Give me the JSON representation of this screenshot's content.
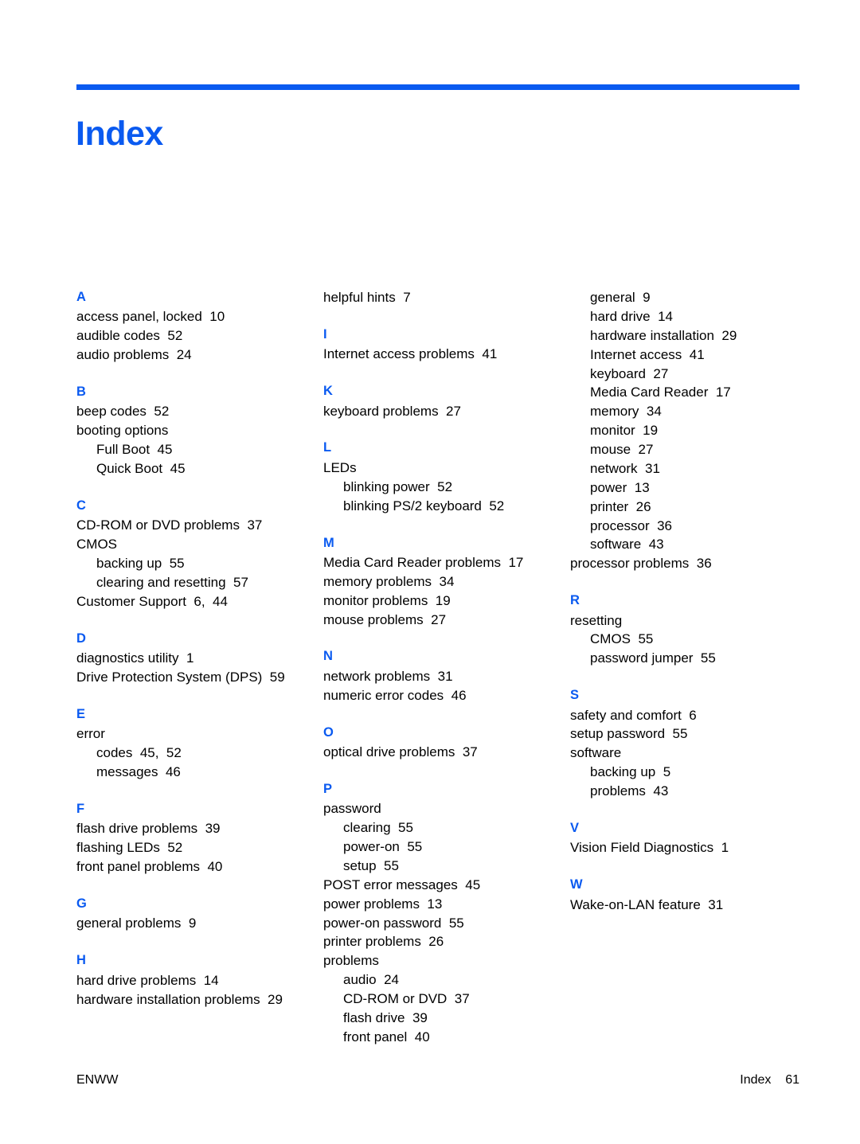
{
  "document": {
    "title": "Index",
    "accent_color": "#0A5AF0",
    "text_color": "#000000"
  },
  "footer": {
    "left": "ENWW",
    "right": "Index    61"
  },
  "columns": [
    {
      "id": "column-1",
      "groups": [
        {
          "letter": "A",
          "entries": [
            {
              "text": "access panel, locked",
              "locator": "10",
              "level": 0
            },
            {
              "text": "audible codes",
              "locator": "52",
              "level": 0
            },
            {
              "text": "audio problems",
              "locator": "24",
              "level": 0
            }
          ]
        },
        {
          "letter": "B",
          "entries": [
            {
              "text": "beep codes",
              "locator": "52",
              "level": 0
            },
            {
              "text": "booting options",
              "locator": "",
              "level": 0
            },
            {
              "text": "Full Boot",
              "locator": "45",
              "level": 1
            },
            {
              "text": "Quick Boot",
              "locator": "45",
              "level": 1
            }
          ]
        },
        {
          "letter": "C",
          "entries": [
            {
              "text": "CD-ROM or DVD problems",
              "locator": "37",
              "level": 0
            },
            {
              "text": "CMOS",
              "locator": "",
              "level": 0
            },
            {
              "text": "backing up",
              "locator": "55",
              "level": 1
            },
            {
              "text": "clearing and resetting",
              "locator": "57",
              "level": 1
            },
            {
              "text": "Customer Support",
              "locator": "6,  44",
              "level": 0
            }
          ]
        },
        {
          "letter": "D",
          "entries": [
            {
              "text": "diagnostics utility",
              "locator": "1",
              "level": 0
            },
            {
              "text": "Drive Protection System (DPS)",
              "locator": "59",
              "level": 0
            }
          ]
        },
        {
          "letter": "E",
          "entries": [
            {
              "text": "error",
              "locator": "",
              "level": 0
            },
            {
              "text": "codes",
              "locator": "45,  52",
              "level": 1
            },
            {
              "text": "messages",
              "locator": "46",
              "level": 1
            }
          ]
        },
        {
          "letter": "F",
          "entries": [
            {
              "text": "flash drive problems",
              "locator": "39",
              "level": 0
            },
            {
              "text": "flashing LEDs",
              "locator": "52",
              "level": 0
            },
            {
              "text": "front panel problems",
              "locator": "40",
              "level": 0
            }
          ]
        },
        {
          "letter": "G",
          "entries": [
            {
              "text": "general problems",
              "locator": "9",
              "level": 0
            }
          ]
        },
        {
          "letter": "H",
          "entries": [
            {
              "text": "hard drive problems",
              "locator": "14",
              "level": 0
            },
            {
              "text": "hardware installation problems",
              "locator": "29",
              "level": 0
            }
          ]
        }
      ]
    },
    {
      "id": "column-2",
      "continued": [
        {
          "text": "helpful hints",
          "locator": "7",
          "level": 0
        }
      ],
      "groups": [
        {
          "letter": "I",
          "entries": [
            {
              "text": "Internet access problems",
              "locator": "41",
              "level": 0
            }
          ]
        },
        {
          "letter": "K",
          "entries": [
            {
              "text": "keyboard problems",
              "locator": "27",
              "level": 0
            }
          ]
        },
        {
          "letter": "L",
          "entries": [
            {
              "text": "LEDs",
              "locator": "",
              "level": 0
            },
            {
              "text": "blinking power",
              "locator": "52",
              "level": 1
            },
            {
              "text": "blinking PS/2 keyboard",
              "locator": "52",
              "level": 1
            }
          ]
        },
        {
          "letter": "M",
          "entries": [
            {
              "text": "Media Card Reader problems",
              "locator": "17",
              "level": 0
            },
            {
              "text": "memory problems",
              "locator": "34",
              "level": 0
            },
            {
              "text": "monitor problems",
              "locator": "19",
              "level": 0
            },
            {
              "text": "mouse problems",
              "locator": "27",
              "level": 0
            }
          ]
        },
        {
          "letter": "N",
          "entries": [
            {
              "text": "network problems",
              "locator": "31",
              "level": 0
            },
            {
              "text": "numeric error codes",
              "locator": "46",
              "level": 0
            }
          ]
        },
        {
          "letter": "O",
          "entries": [
            {
              "text": "optical drive problems",
              "locator": "37",
              "level": 0
            }
          ]
        },
        {
          "letter": "P",
          "entries": [
            {
              "text": "password",
              "locator": "",
              "level": 0
            },
            {
              "text": "clearing",
              "locator": "55",
              "level": 1
            },
            {
              "text": "power-on",
              "locator": "55",
              "level": 1
            },
            {
              "text": "setup",
              "locator": "55",
              "level": 1
            },
            {
              "text": "POST error messages",
              "locator": "45",
              "level": 0
            },
            {
              "text": "power problems",
              "locator": "13",
              "level": 0
            },
            {
              "text": "power-on password",
              "locator": "55",
              "level": 0
            },
            {
              "text": "printer problems",
              "locator": "26",
              "level": 0
            },
            {
              "text": "problems",
              "locator": "",
              "level": 0
            },
            {
              "text": "audio",
              "locator": "24",
              "level": 1
            },
            {
              "text": "CD-ROM or DVD",
              "locator": "37",
              "level": 1
            },
            {
              "text": "flash drive",
              "locator": "39",
              "level": 1
            },
            {
              "text": "front panel",
              "locator": "40",
              "level": 1
            }
          ]
        }
      ]
    },
    {
      "id": "column-3",
      "continued": [
        {
          "text": "general",
          "locator": "9",
          "level": 1
        },
        {
          "text": "hard drive",
          "locator": "14",
          "level": 1
        },
        {
          "text": "hardware installation",
          "locator": "29",
          "level": 1
        },
        {
          "text": "Internet access",
          "locator": "41",
          "level": 1
        },
        {
          "text": "keyboard",
          "locator": "27",
          "level": 1
        },
        {
          "text": "Media Card Reader",
          "locator": "17",
          "level": 1
        },
        {
          "text": "memory",
          "locator": "34",
          "level": 1
        },
        {
          "text": "monitor",
          "locator": "19",
          "level": 1
        },
        {
          "text": "mouse",
          "locator": "27",
          "level": 1
        },
        {
          "text": "network",
          "locator": "31",
          "level": 1
        },
        {
          "text": "power",
          "locator": "13",
          "level": 1
        },
        {
          "text": "printer",
          "locator": "26",
          "level": 1
        },
        {
          "text": "processor",
          "locator": "36",
          "level": 1
        },
        {
          "text": "software",
          "locator": "43",
          "level": 1
        },
        {
          "text": "processor problems",
          "locator": "36",
          "level": 0
        }
      ],
      "groups": [
        {
          "letter": "R",
          "entries": [
            {
              "text": "resetting",
              "locator": "",
              "level": 0
            },
            {
              "text": "CMOS",
              "locator": "55",
              "level": 1
            },
            {
              "text": "password jumper",
              "locator": "55",
              "level": 1
            }
          ]
        },
        {
          "letter": "S",
          "entries": [
            {
              "text": "safety and comfort",
              "locator": "6",
              "level": 0
            },
            {
              "text": "setup password",
              "locator": "55",
              "level": 0
            },
            {
              "text": "software",
              "locator": "",
              "level": 0
            },
            {
              "text": "backing up",
              "locator": "5",
              "level": 1
            },
            {
              "text": "problems",
              "locator": "43",
              "level": 1
            }
          ]
        },
        {
          "letter": "V",
          "entries": [
            {
              "text": "Vision Field Diagnostics",
              "locator": "1",
              "level": 0
            }
          ]
        },
        {
          "letter": "W",
          "entries": [
            {
              "text": "Wake-on-LAN feature",
              "locator": "31",
              "level": 0
            }
          ]
        }
      ]
    }
  ]
}
